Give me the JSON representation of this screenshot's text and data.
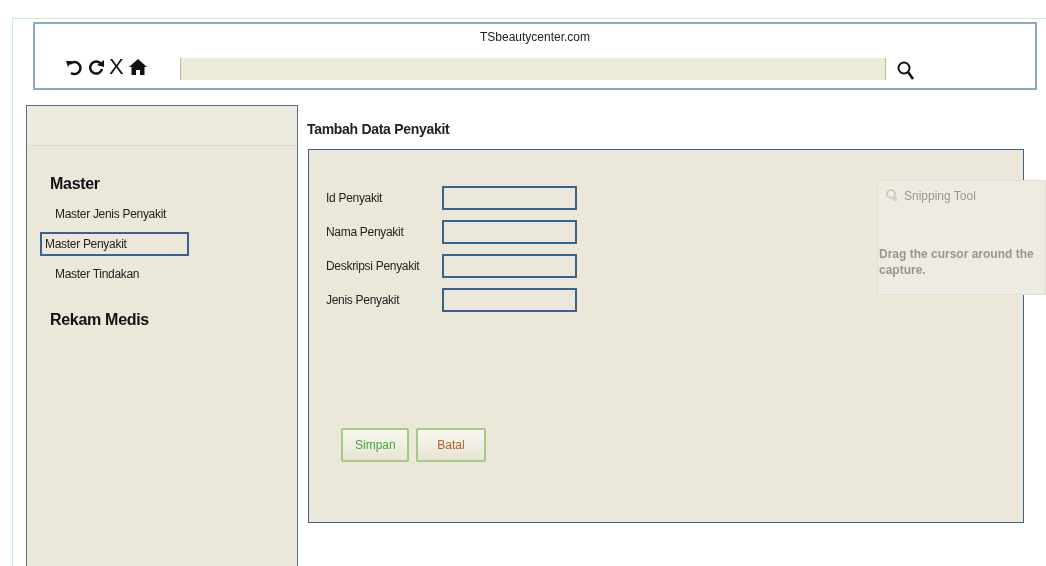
{
  "browser": {
    "url_title": "TSbeautycenter.com",
    "controls": [
      {
        "kind": "undo"
      },
      {
        "kind": "reload"
      },
      {
        "kind": "stop",
        "label": "X"
      },
      {
        "kind": "home"
      }
    ]
  },
  "sidebar": {
    "sections": [
      {
        "title": "Master",
        "items": [
          {
            "label": "Master Jenis Penyakit",
            "selected": false
          },
          {
            "label": "Master Penyakit",
            "selected": true
          },
          {
            "label": "Master Tindakan",
            "selected": false
          }
        ]
      },
      {
        "title": "Rekam Medis"
      }
    ]
  },
  "form": {
    "title": "Tambah Data Penyakit",
    "fields": [
      {
        "label": "Id Penyakit"
      },
      {
        "label": "Nama Penyakit"
      },
      {
        "label": "Deskripsi Penyakit"
      },
      {
        "label": "Jenis Penyakit"
      }
    ],
    "buttons": [
      {
        "label": "Simpan",
        "kind": "save"
      },
      {
        "label": "Batal",
        "kind": "cancel"
      }
    ]
  },
  "snipping_overlay": {
    "title": "Snipping Tool",
    "lines": [
      "Drag the cursor around the",
      "capture."
    ]
  }
}
